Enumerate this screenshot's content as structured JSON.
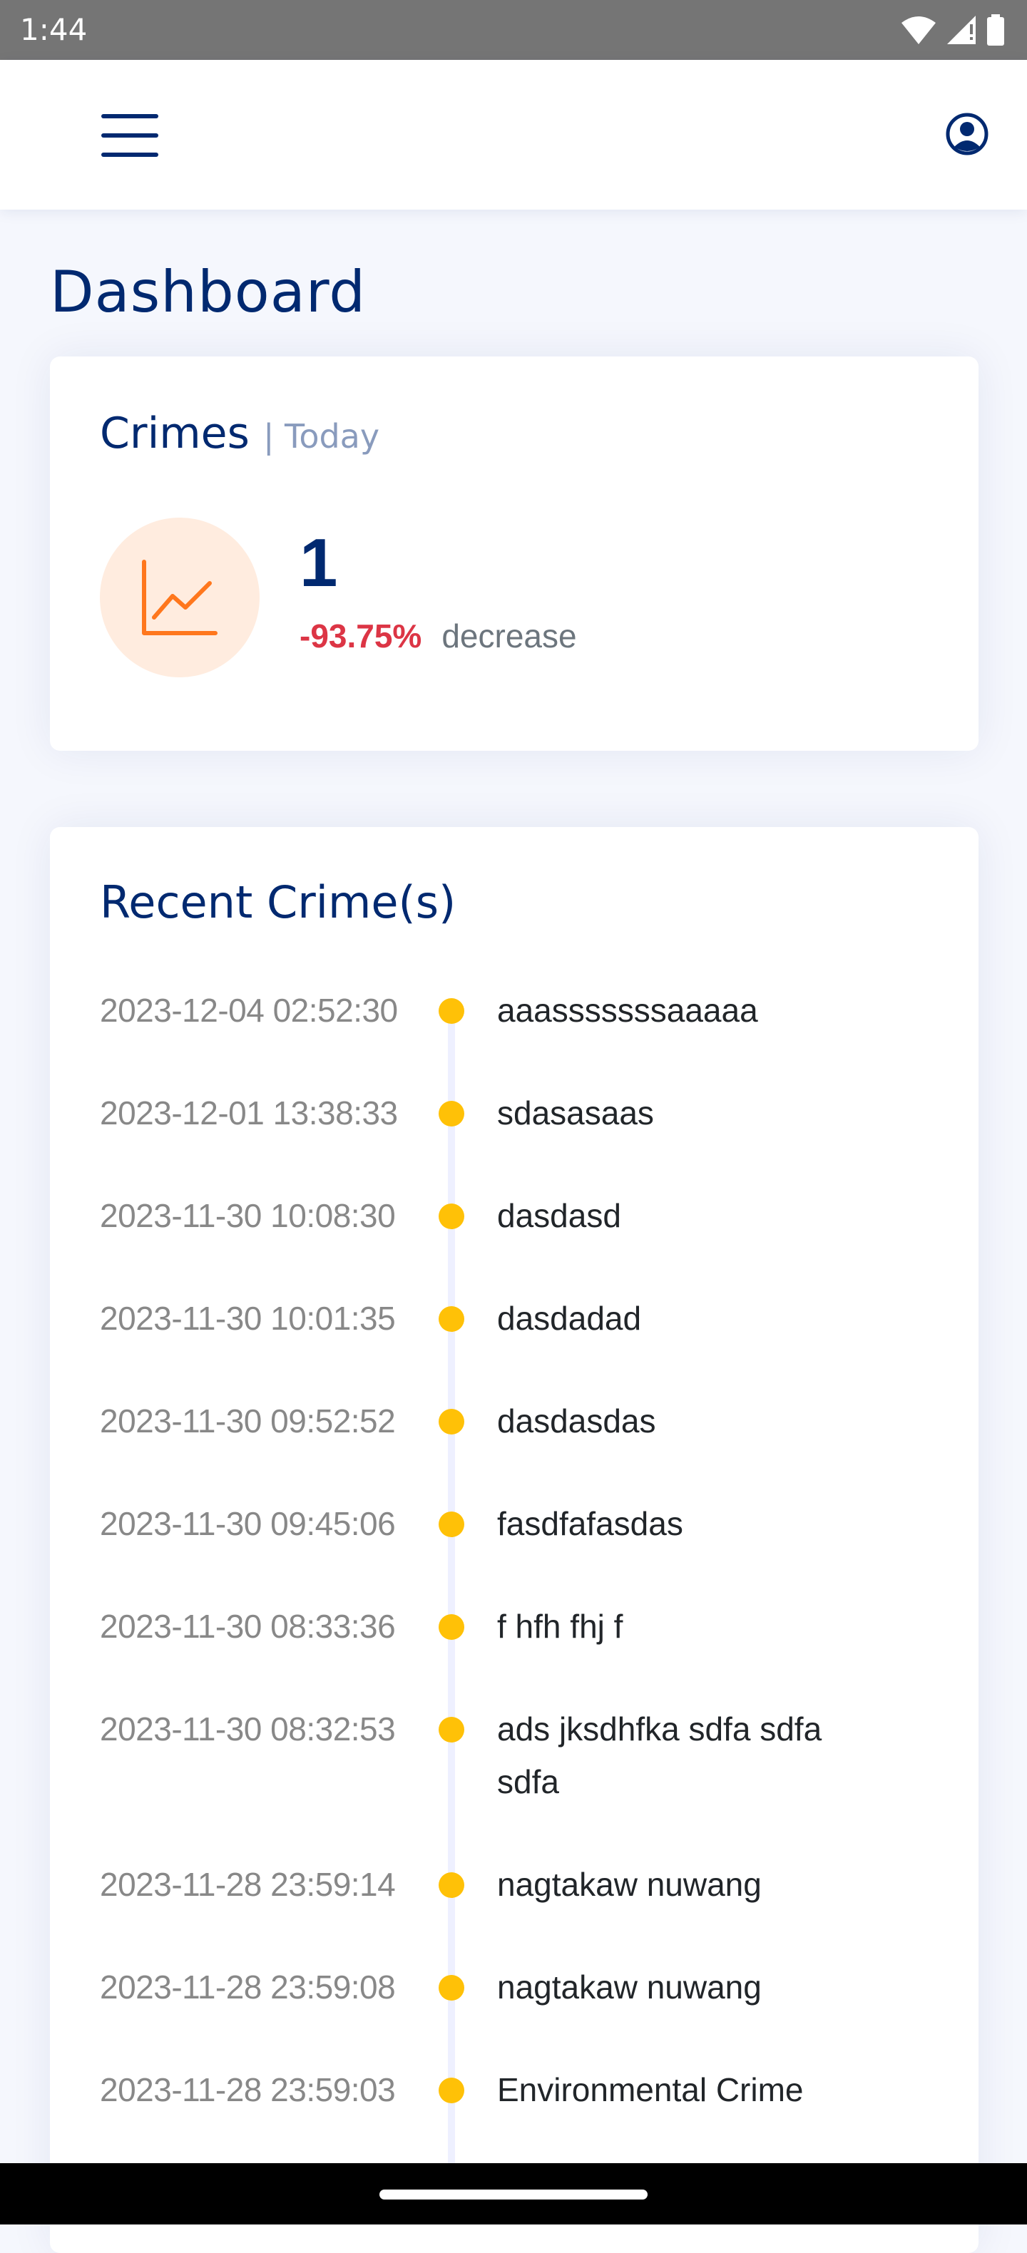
{
  "status_bar": {
    "time": "1:44",
    "icons": [
      "wifi-icon",
      "signal-icon",
      "battery-icon"
    ]
  },
  "header": {
    "menu_icon": "hamburger-menu-icon",
    "profile_icon": "user-circle-icon"
  },
  "page": {
    "title": "Dashboard"
  },
  "crimes_card": {
    "title": "Crimes",
    "period": "| Today",
    "icon": "graph-up-icon",
    "count": "1",
    "change_percent": "-93.75%",
    "change_word": "decrease"
  },
  "recent_card": {
    "title": "Recent Crime(s)",
    "items": [
      {
        "time": "2023-12-04 02:52:30",
        "text": "aaasssssssaaaaa"
      },
      {
        "time": "2023-12-01 13:38:33",
        "text": "sdasasaas"
      },
      {
        "time": "2023-11-30 10:08:30",
        "text": "dasdasd"
      },
      {
        "time": "2023-11-30 10:01:35",
        "text": "dasdadad"
      },
      {
        "time": "2023-11-30 09:52:52",
        "text": "dasdasdas"
      },
      {
        "time": "2023-11-30 09:45:06",
        "text": "fasdfafasdas"
      },
      {
        "time": "2023-11-30 08:33:36",
        "text": "f hfh fhj f"
      },
      {
        "time": "2023-11-30 08:32:53",
        "text": "ads jksdhfka sdfa sdfa sdfa"
      },
      {
        "time": "2023-11-28 23:59:14",
        "text": "nagtakaw nuwang"
      },
      {
        "time": "2023-11-28 23:59:08",
        "text": "nagtakaw nuwang"
      },
      {
        "time": "2023-11-28 23:59:03",
        "text": "Environmental Crime"
      }
    ]
  },
  "colors": {
    "primary": "#012970",
    "accent_dot": "#ffc107",
    "decrease": "#dc3545",
    "icon_bg": "#ffecdf",
    "icon_stroke": "#ff771d"
  }
}
